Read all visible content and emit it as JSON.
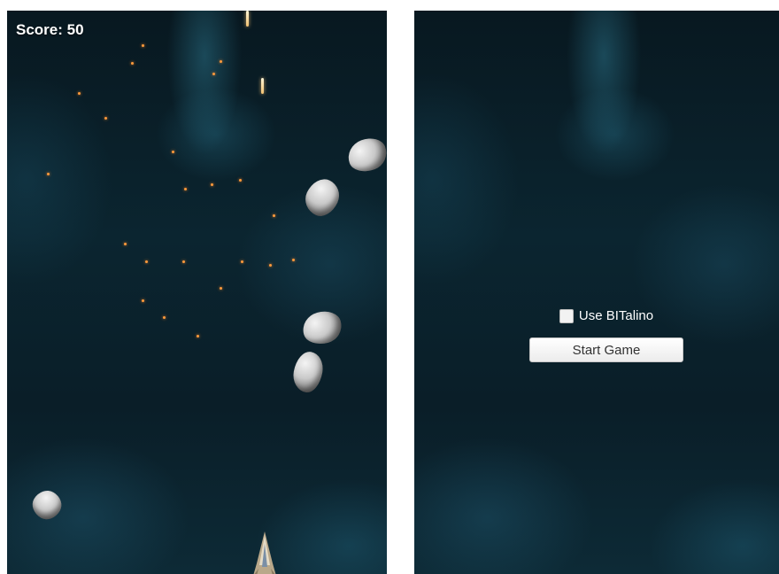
{
  "game_screen": {
    "score_text": "Score: 50"
  },
  "menu_screen": {
    "toggle": {
      "label": "Use BITalino",
      "checked": false
    },
    "start_button_label": "Start Game"
  },
  "colors": {
    "space_background": "#0b2530",
    "nebula": "#3aa0be",
    "spark": "#ff9a3c"
  }
}
